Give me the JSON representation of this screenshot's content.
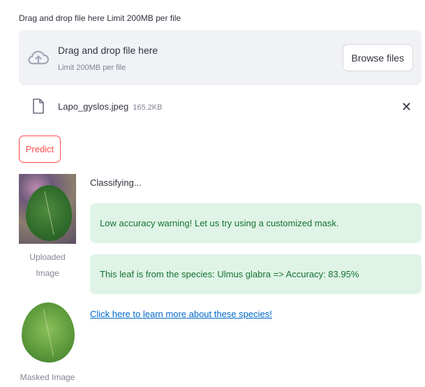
{
  "uploader": {
    "label": "Drag and drop file here Limit 200MB per file",
    "dropzone_title": "Drag and drop file here",
    "dropzone_subtitle": "Limit 200MB per file",
    "browse_label": "Browse files",
    "file": {
      "name": "Lapo_gyslos.jpeg",
      "size": "165.2KB"
    }
  },
  "predict_button": "Predict",
  "images": {
    "uploaded_caption_line1": "Uploaded",
    "uploaded_caption_line2": "Image",
    "masked_caption": "Masked Image"
  },
  "results": {
    "status": "Classifying...",
    "warning": "Low accuracy warning! Let us try using a customized mask.",
    "prediction": "This leaf is from the species: Ulmus glabra => Accuracy: 83.95%",
    "link": "Click here to learn more about these species!"
  },
  "colors": {
    "accent": "#ff4b4b",
    "success_bg": "#dff4e6",
    "success_text": "#177233",
    "link": "#0068c9"
  }
}
